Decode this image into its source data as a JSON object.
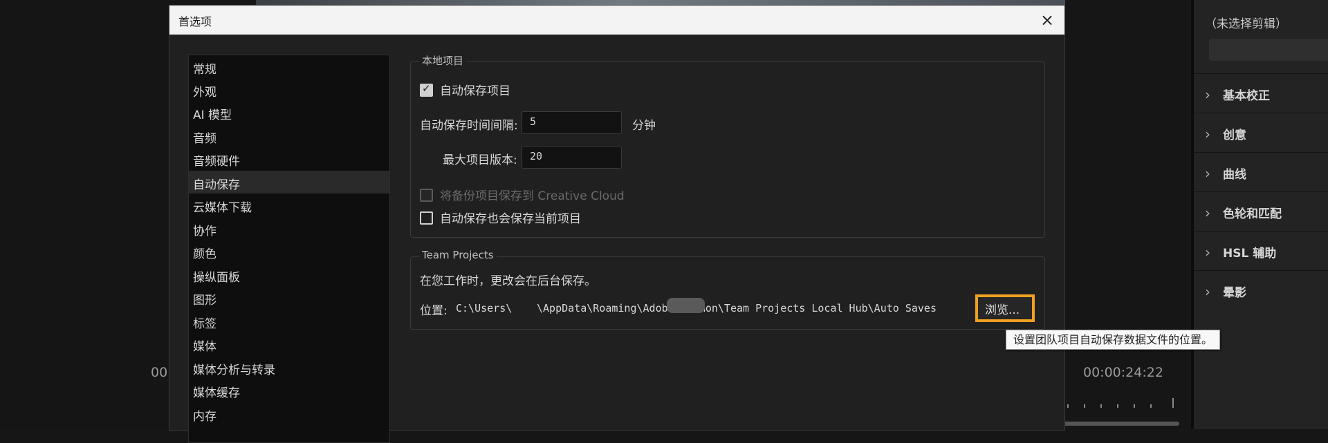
{
  "background": {
    "timecode_left": "00:",
    "timecode_right": "00:00:24:22",
    "right_panel": {
      "title": "（未选择剪辑）",
      "sections": [
        "基本校正",
        "创意",
        "曲线",
        "色轮和匹配",
        "HSL 辅助",
        "晕影"
      ]
    }
  },
  "dialog": {
    "title": "首选项",
    "close_icon": "×",
    "nav_items": [
      "常规",
      "外观",
      "AI 模型",
      "音频",
      "音频硬件",
      "自动保存",
      "云媒体下载",
      "协作",
      "颜色",
      "操纵面板",
      "图形",
      "标签",
      "媒体",
      "媒体分析与转录",
      "媒体缓存",
      "内存"
    ],
    "nav_active_index": 5,
    "local_project": {
      "legend": "本地项目",
      "auto_save_label": "自动保存项目",
      "auto_save_checked": true,
      "interval_label": "自动保存时间间隔:",
      "interval_value": "5",
      "interval_unit": "分钟",
      "max_versions_label": "最大项目版本:",
      "max_versions_value": "20",
      "creative_cloud_label": "将备份项目保存到 Creative Cloud",
      "creative_cloud_checked": false,
      "save_current_label": "自动保存也会保存当前项目",
      "save_current_checked": false
    },
    "team_projects": {
      "legend": "Team Projects",
      "info": "在您工作时，更改会在后台保存。",
      "location_label": "位置:",
      "path_prefix": "C:\\Users\\",
      "path_suffix": "\\AppData\\Roaming\\Adobe\\Common\\Team Projects Local Hub\\Auto Saves",
      "browse_label": "浏览..."
    },
    "tooltip": "设置团队项目自动保存数据文件的位置。"
  },
  "colors": {
    "highlight": "#f0a020",
    "dialog_bg": "#202020",
    "titlebar_bg": "#f3f3f3"
  }
}
